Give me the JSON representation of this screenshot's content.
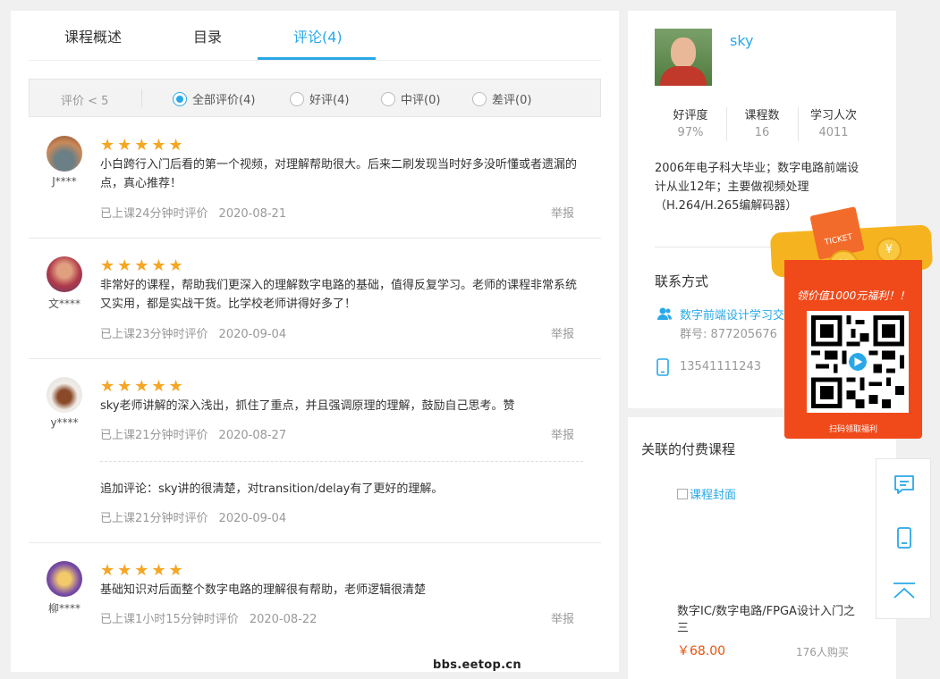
{
  "tabs": [
    {
      "label": "课程概述"
    },
    {
      "label": "目录"
    },
    {
      "label": "评论(4)"
    }
  ],
  "filter": {
    "label": "评价 < 5",
    "options": [
      {
        "label": "全部评价(4)",
        "selected": true
      },
      {
        "label": "好评(4)",
        "selected": false
      },
      {
        "label": "中评(0)",
        "selected": false
      },
      {
        "label": "差评(0)",
        "selected": false
      }
    ]
  },
  "reviews": [
    {
      "user": "J****",
      "rating": 5,
      "text": "小白跨行入门后看的第一个视频，对理解帮助很大。后来二刷发现当时好多没听懂或者遗漏的点，真心推荐！",
      "meta": "已上课24分钟时评价",
      "date": "2020-08-21",
      "report": "举报"
    },
    {
      "user": "文****",
      "rating": 5,
      "text": "非常好的课程，帮助我们更深入的理解数字电路的基础，值得反复学习。老师的课程非常系统又实用，都是实战干货。比学校老师讲得好多了！",
      "meta": "已上课23分钟时评价",
      "date": "2020-09-04",
      "report": "举报"
    },
    {
      "user": "y****",
      "rating": 5,
      "text": "sky老师讲解的深入浅出，抓住了重点，并且强调原理的理解，鼓励自己思考。赞",
      "meta": "已上课21分钟时评价",
      "date": "2020-08-27",
      "report": "举报",
      "followup": {
        "text": "追加评论：sky讲的很清楚，对transition/delay有了更好的理解。",
        "meta": "已上课21分钟时评价",
        "date": "2020-09-04"
      }
    },
    {
      "user": "柳****",
      "rating": 5,
      "text": "基础知识对后面整个数字电路的理解很有帮助，老师逻辑很清楚",
      "meta": "已上课1小时15分钟时评价",
      "date": "2020-08-22",
      "report": "举报"
    }
  ],
  "teacher": {
    "name": "sky",
    "stats": [
      {
        "label": "好评度",
        "value": "97%"
      },
      {
        "label": "课程数",
        "value": "16"
      },
      {
        "label": "学习人次",
        "value": "4011"
      }
    ],
    "bio": "2006年电子科大毕业；数字电路前端设计从业12年；主要做视频处理（H.264/H.265编解码器）",
    "contact_title": "联系方式",
    "group_name": "数字前端设计学习交",
    "group_no": "群号: 877205676",
    "phone": "13541111243"
  },
  "promo": {
    "ticket": "TICKET",
    "coin_symbol": "¥",
    "welfare": "领价值1000元福利！！",
    "scan": "扫码领取福利"
  },
  "related": {
    "title": "关联的付费课程",
    "cover_alt": "课程封面",
    "course_name": "数字IC/数字电路/FPGA设计入门之三",
    "price": "￥68.00",
    "buyers": "176人购买"
  },
  "watermark": "bbs.eetop.cn",
  "colors": {
    "accent": "#29a8e8",
    "star": "#f5a623",
    "price": "#e6530b",
    "promo": "#f04a1b"
  }
}
